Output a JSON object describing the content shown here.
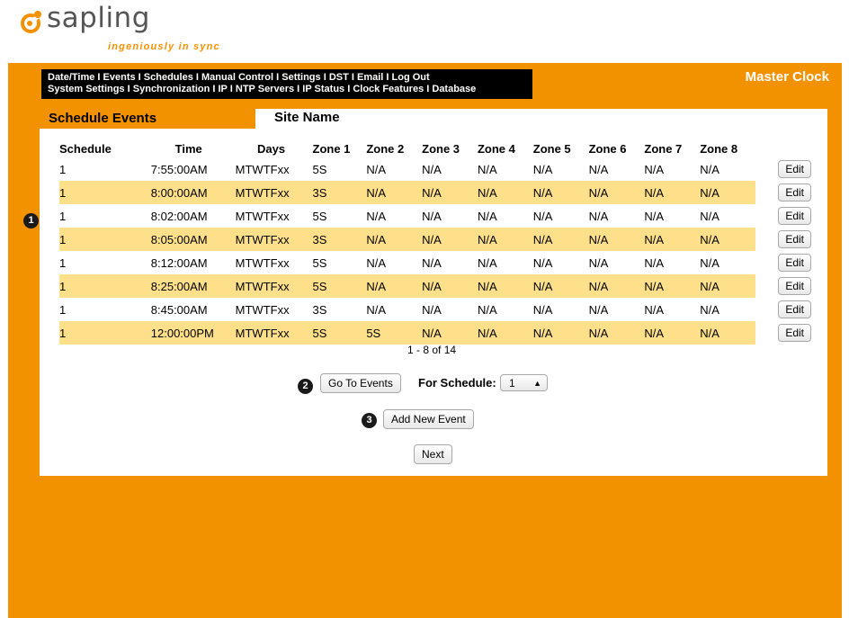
{
  "brand": {
    "name": "sapling",
    "tagline": "ingeniously in sync"
  },
  "nav": {
    "row1": [
      "Date/Time",
      "Events",
      "Schedules",
      "Manual Control",
      "Settings",
      "DST",
      "Email",
      "Log Out"
    ],
    "row2": [
      "System Settings",
      "Synchronization",
      "IP",
      "NTP Servers",
      "IP Status",
      "Clock Features",
      "Database"
    ],
    "separator": " I "
  },
  "device_label": "Master Clock",
  "page_title": "Schedule Events",
  "site_name": "Site Name",
  "table": {
    "headers": [
      "Schedule",
      "Time",
      "Days",
      "Zone 1",
      "Zone 2",
      "Zone 3",
      "Zone 4",
      "Zone 5",
      "Zone 6",
      "Zone 7",
      "Zone 8"
    ],
    "edit_label": "Edit",
    "rows": [
      [
        "1",
        "7:55:00AM",
        "MTWTFxx",
        "5S",
        "N/A",
        "N/A",
        "N/A",
        "N/A",
        "N/A",
        "N/A",
        "N/A"
      ],
      [
        "1",
        "8:00:00AM",
        "MTWTFxx",
        "3S",
        "N/A",
        "N/A",
        "N/A",
        "N/A",
        "N/A",
        "N/A",
        "N/A"
      ],
      [
        "1",
        "8:02:00AM",
        "MTWTFxx",
        "5S",
        "N/A",
        "N/A",
        "N/A",
        "N/A",
        "N/A",
        "N/A",
        "N/A"
      ],
      [
        "1",
        "8:05:00AM",
        "MTWTFxx",
        "3S",
        "N/A",
        "N/A",
        "N/A",
        "N/A",
        "N/A",
        "N/A",
        "N/A"
      ],
      [
        "1",
        "8:12:00AM",
        "MTWTFxx",
        "5S",
        "N/A",
        "N/A",
        "N/A",
        "N/A",
        "N/A",
        "N/A",
        "N/A"
      ],
      [
        "1",
        "8:25:00AM",
        "MTWTFxx",
        "5S",
        "N/A",
        "N/A",
        "N/A",
        "N/A",
        "N/A",
        "N/A",
        "N/A"
      ],
      [
        "1",
        "8:45:00AM",
        "MTWTFxx",
        "3S",
        "N/A",
        "N/A",
        "N/A",
        "N/A",
        "N/A",
        "N/A",
        "N/A"
      ],
      [
        "1",
        "12:00:00PM",
        "MTWTFxx",
        "5S",
        "5S",
        "N/A",
        "N/A",
        "N/A",
        "N/A",
        "N/A",
        "N/A"
      ]
    ]
  },
  "pager_text": "1 - 8 of 14",
  "controls": {
    "go_to_events": "Go To Events",
    "for_schedule_label": "For Schedule:",
    "schedule_selected": "1",
    "add_new_event": "Add New Event",
    "next": "Next"
  },
  "callouts": [
    "1",
    "2",
    "3"
  ],
  "colors": {
    "background": "#f39200",
    "highlight_row": "#ffe08a",
    "nav_bg": "#000000"
  }
}
